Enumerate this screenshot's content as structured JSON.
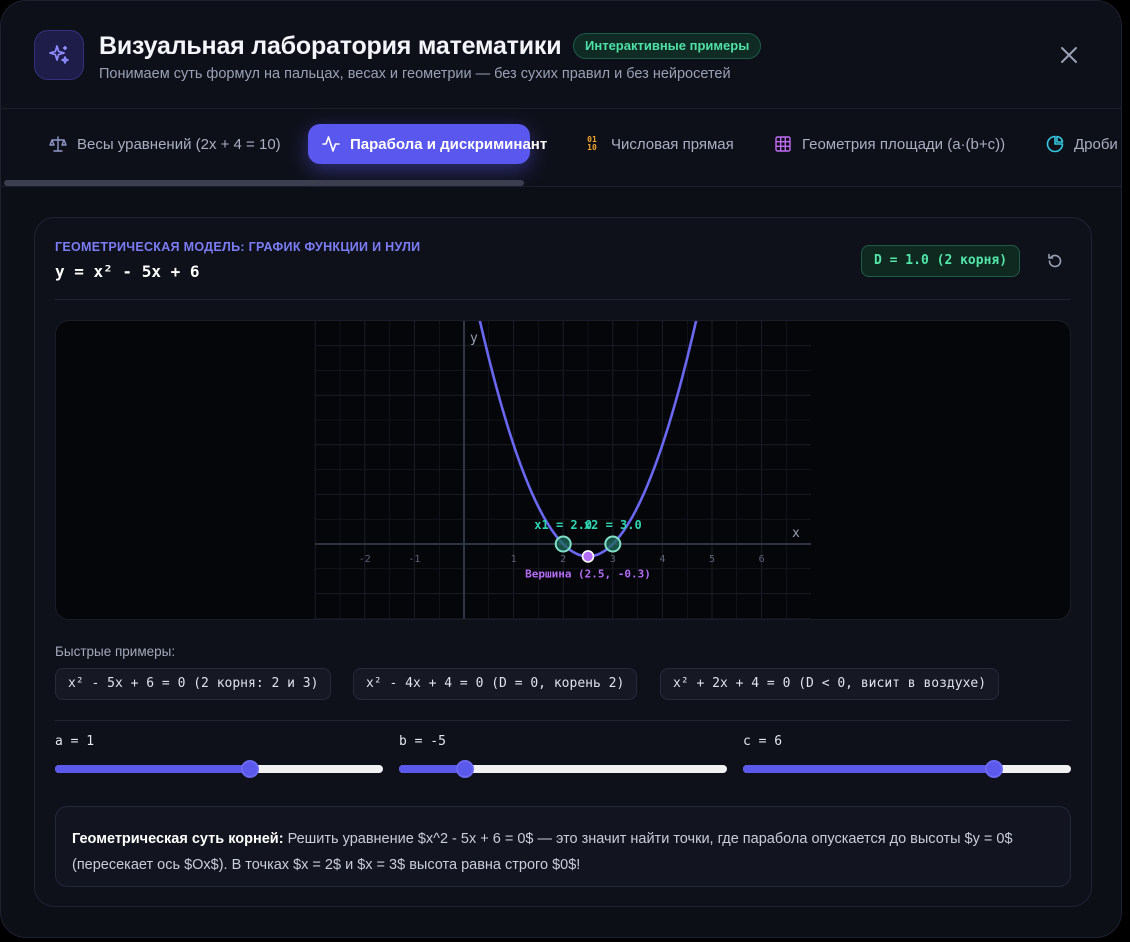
{
  "header": {
    "title": "Визуальная лаборатория математики",
    "badge": "Интерактивные примеры",
    "subtitle": "Понимаем суть формул на пальцах, весах и геометрии — без сухих правил и без нейросетей",
    "logo_icon": "sparkles-icon",
    "close_icon": "close-icon"
  },
  "tabs": [
    {
      "label": "Весы уравнений (2x + 4 = 10)",
      "icon": "scales-icon",
      "active": false
    },
    {
      "label": "Парабола и дискриминант",
      "icon": "activity-icon",
      "active": true
    },
    {
      "label": "Числовая прямая",
      "icon": "binary-icon",
      "active": false
    },
    {
      "label": "Геометрия площади (a·(b+c))",
      "icon": "grid-icon",
      "active": false
    },
    {
      "label": "Дроби",
      "icon": "pie-icon",
      "active": false
    }
  ],
  "model": {
    "label": "ГЕОМЕТРИЧЕСКАЯ МОДЕЛЬ: ГРАФИК ФУНКЦИИ И НУЛИ",
    "formula": "y = x² - 5x + 6",
    "discriminant_badge": "D = 1.0 (2 корня)"
  },
  "chart_data": {
    "type": "line",
    "function": "y = x² - 5x + 6",
    "coefficients": {
      "a": 1,
      "b": -5,
      "c": 6
    },
    "xlabel": "x",
    "ylabel": "y",
    "x_ticks": [
      "-2",
      "-1",
      "1",
      "2",
      "3",
      "4",
      "5",
      "6"
    ],
    "xlim": [
      -3,
      7
    ],
    "ylim": [
      -1.5,
      4.5
    ],
    "grid": true,
    "roots": [
      {
        "x": 2,
        "y": 0,
        "label": "x1 = 2.0"
      },
      {
        "x": 3,
        "y": 0,
        "label": "x2 = 3.0"
      }
    ],
    "vertex": {
      "x": 2.5,
      "y": -0.25,
      "label": "Вершина (2.5, -0.3)"
    },
    "colors": {
      "curve": "#6a67f0",
      "roots": "#2fd4b0",
      "vertex": "#b36cf4",
      "grid": "#1a1d27",
      "axis": "#3c4052"
    }
  },
  "quick": {
    "title": "Быстрые примеры:",
    "examples": [
      "x² - 5x + 6 = 0 (2 корня: 2 и 3)",
      "x² - 4x + 4 = 0 (D = 0, корень 2)",
      "x² + 2x + 4 = 0 (D < 0, висит в воздухе)"
    ]
  },
  "sliders": [
    {
      "label": "a = 1",
      "value": 1,
      "fraction": 0.595
    },
    {
      "label": "b = -5",
      "value": -5,
      "fraction": 0.2
    },
    {
      "label": "c = 6",
      "value": 6,
      "fraction": 0.765
    }
  ],
  "note": {
    "bold": "Геометрическая суть корней:",
    "text": " Решить уравнение $x^2 - 5x + 6 = 0$ — это значит найти точки, где парабола опускается до высоты $y = 0$ (пересекает ось $Ox$). В точках $x = 2$ и $x = 3$ высота равна строго $0$!"
  },
  "colors": {
    "accent": "#5a57ee",
    "badge_green": "#4fe0a6",
    "background": "#0d0f17"
  }
}
